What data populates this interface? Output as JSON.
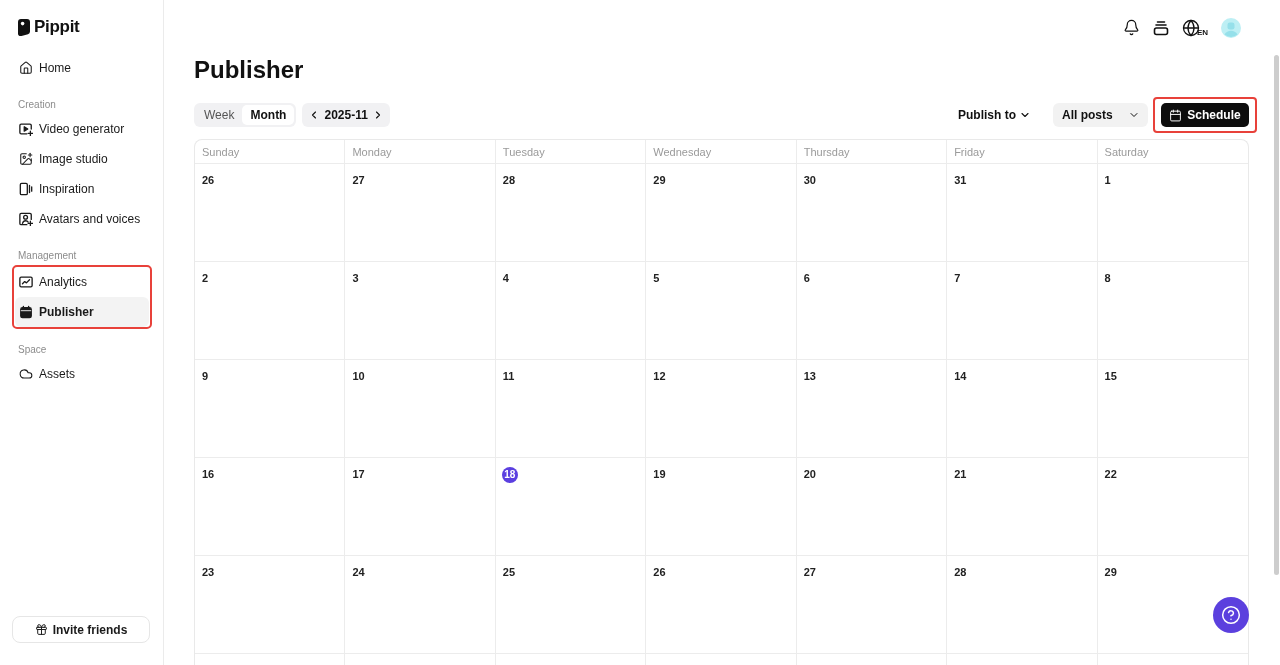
{
  "sidebar": {
    "logo": "Pippit",
    "sections": [
      {
        "items": [
          {
            "label": "Home",
            "selected": false
          }
        ]
      },
      {
        "title": "Creation",
        "items": [
          {
            "label": "Video generator",
            "selected": false
          },
          {
            "label": "Image studio",
            "selected": false
          },
          {
            "label": "Inspiration",
            "selected": false
          },
          {
            "label": "Avatars and voices",
            "selected": false
          }
        ]
      },
      {
        "title": "Management",
        "highlighted": true,
        "items": [
          {
            "label": "Analytics",
            "selected": false
          },
          {
            "label": "Publisher",
            "selected": true
          }
        ]
      },
      {
        "title": "Space",
        "items": [
          {
            "label": "Assets",
            "selected": false
          }
        ]
      }
    ],
    "invite_button": "Invite friends"
  },
  "top_bar": {
    "language": "EN"
  },
  "page": {
    "title": "Publisher"
  },
  "toolbar": {
    "view_tabs": [
      {
        "label": "Week",
        "selected": false
      },
      {
        "label": "Month",
        "selected": true
      }
    ],
    "month": "2025-11",
    "publish_to": "Publish to",
    "filter": "All posts",
    "schedule": {
      "label": "Schedule",
      "highlighted": true
    }
  },
  "calendar": {
    "weekdays": [
      "Sunday",
      "Monday",
      "Tuesday",
      "Wednesday",
      "Thursday",
      "Friday",
      "Saturday"
    ],
    "weeks": [
      {
        "days": [
          {
            "date": "26",
            "today": false
          },
          {
            "date": "27",
            "today": false
          },
          {
            "date": "28",
            "today": false
          },
          {
            "date": "29",
            "today": false
          },
          {
            "date": "30",
            "today": false
          },
          {
            "date": "31",
            "today": false
          },
          {
            "date": "1",
            "today": false
          }
        ]
      },
      {
        "days": [
          {
            "date": "2",
            "today": false
          },
          {
            "date": "3",
            "today": false
          },
          {
            "date": "4",
            "today": false
          },
          {
            "date": "5",
            "today": false
          },
          {
            "date": "6",
            "today": false
          },
          {
            "date": "7",
            "today": false
          },
          {
            "date": "8",
            "today": false
          }
        ]
      },
      {
        "days": [
          {
            "date": "9",
            "today": false
          },
          {
            "date": "10",
            "today": false
          },
          {
            "date": "11",
            "today": false
          },
          {
            "date": "12",
            "today": false
          },
          {
            "date": "13",
            "today": false
          },
          {
            "date": "14",
            "today": false
          },
          {
            "date": "15",
            "today": false
          }
        ]
      },
      {
        "days": [
          {
            "date": "16",
            "today": false
          },
          {
            "date": "17",
            "today": false
          },
          {
            "date": "18",
            "today": true
          },
          {
            "date": "19",
            "today": false
          },
          {
            "date": "20",
            "today": false
          },
          {
            "date": "21",
            "today": false
          },
          {
            "date": "22",
            "today": false
          }
        ]
      },
      {
        "days": [
          {
            "date": "23",
            "today": false
          },
          {
            "date": "24",
            "today": false
          },
          {
            "date": "25",
            "today": false
          },
          {
            "date": "26",
            "today": false
          },
          {
            "date": "27",
            "today": false
          },
          {
            "date": "28",
            "today": false
          },
          {
            "date": "29",
            "today": false
          }
        ]
      }
    ]
  }
}
